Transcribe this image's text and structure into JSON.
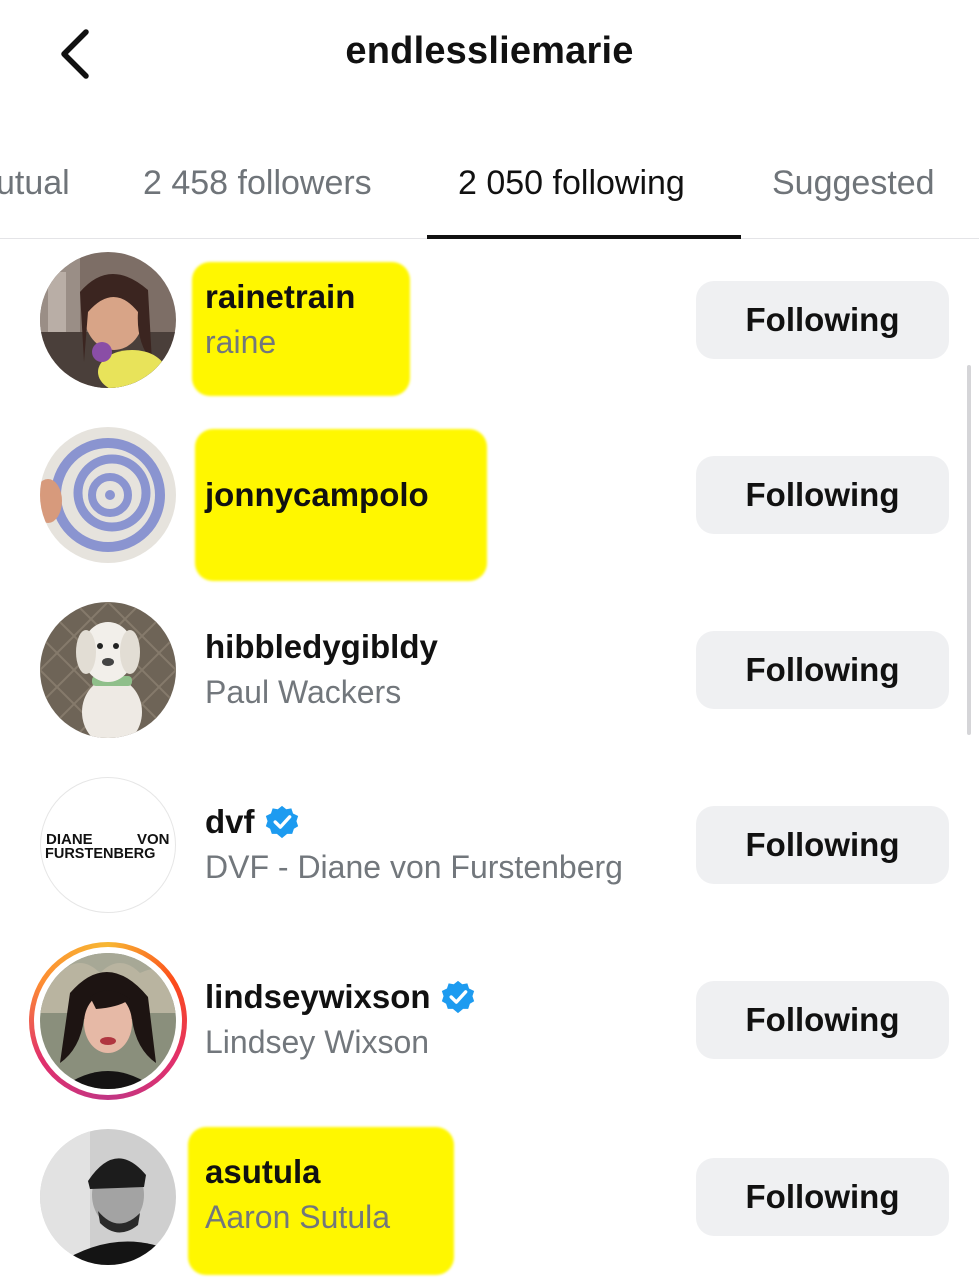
{
  "header": {
    "title": "endlessliemarie",
    "back_icon": "chevron-left-icon"
  },
  "tabs": [
    {
      "label": "utual",
      "active": false
    },
    {
      "label": "2 458 followers",
      "active": false
    },
    {
      "label": "2 050 following",
      "active": true
    },
    {
      "label": "Suggested",
      "active": false
    }
  ],
  "accounts": [
    {
      "username": "rainetrain",
      "full_name": "raine",
      "verified": false,
      "button": "Following",
      "highlighted": true
    },
    {
      "username": "jonnycampolo",
      "full_name": "",
      "verified": false,
      "button": "Following",
      "highlighted": true
    },
    {
      "username": "hibbledygibldy",
      "full_name": "Paul Wackers",
      "verified": false,
      "button": "Following",
      "highlighted": false
    },
    {
      "username": "dvf",
      "full_name": "DVF - Diane von Furstenberg",
      "verified": true,
      "button": "Following",
      "highlighted": false,
      "logo_text": [
        "DIANE",
        "VON",
        "FURSTENBERG"
      ]
    },
    {
      "username": "lindseywixson",
      "full_name": "Lindsey Wixson",
      "verified": true,
      "button": "Following",
      "highlighted": false,
      "has_story": true
    },
    {
      "username": "asutula",
      "full_name": "Aaron Sutula",
      "verified": false,
      "button": "Following",
      "highlighted": true
    }
  ],
  "colors": {
    "highlight": "#fff700",
    "verified_badge": "#1d9bf0",
    "button_bg": "#eff0f2",
    "secondary_text": "#72777c"
  }
}
